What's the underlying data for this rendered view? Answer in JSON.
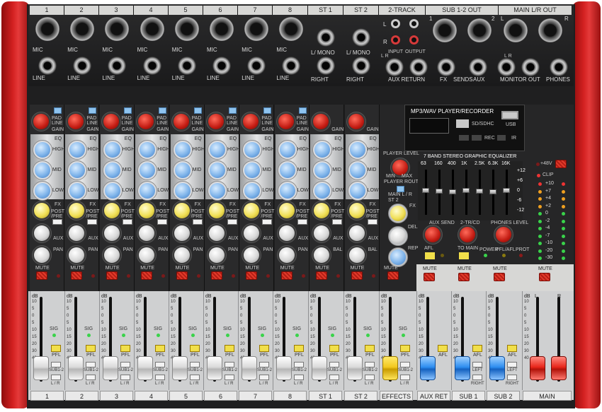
{
  "input_headers": [
    "1",
    "2",
    "3",
    "4",
    "5",
    "6",
    "7",
    "8",
    "ST 1",
    "ST 2",
    "2-TRACK",
    "SUB 1-2 OUT",
    "MAIN L/R OUT"
  ],
  "jacks": {
    "mic": "MIC",
    "line": "LINE",
    "l_mono": "L/ MONO",
    "right": "RIGHT",
    "two_track_l": "L",
    "two_track_r": "R",
    "input": "INPUT",
    "output": "OUTPUT",
    "sub_1": "1",
    "sub_2": "2",
    "main_l": "L",
    "main_r": "R",
    "lr": "L   R",
    "aux_return": "AUX RETURN",
    "fx": "FX",
    "sends": "SENDS",
    "aux": "AUX",
    "monitor_out": "MONITOR OUT",
    "phones": "PHONES"
  },
  "strip": {
    "pad": "PAD",
    "line": "LINE",
    "gain": "GAIN",
    "eq": "EQ",
    "high": "HIGH",
    "mid": "MID",
    "low": "LOW",
    "fx": "FX",
    "post_pre": "POST /PRE",
    "aux": "AUX",
    "pan": "PAN",
    "bal": "BAL",
    "mute": "MUTE",
    "sig": "SIG",
    "pfl": "PFL",
    "sub12": "SUB1-2",
    "lr": "L / R",
    "db": "dB"
  },
  "fader_scale": [
    "10",
    "5",
    "0",
    "5",
    "10",
    "15",
    "20",
    "30",
    "40"
  ],
  "player": {
    "title": "MP3/WAV  PLAYER/RECORDER",
    "sd": "SD/SDHC",
    "usb": "USB",
    "rec": "REC",
    "ir": "IR",
    "level": "PLAYER LEVEL",
    "min": "MIN",
    "max": "MAX",
    "route": "PLAYER ROUTE",
    "main_lr": "MAIN L / R",
    "st2": "ST 2"
  },
  "effects": {
    "fx": "FX",
    "del": "DEL",
    "rep": "REP",
    "min": "MIN",
    "max": "MAX"
  },
  "geq": {
    "title": "7 BAND STEREO GRAPHIC EQUALIZER",
    "bands": [
      "63",
      "160",
      "400",
      "1K",
      "2.5K",
      "6.3K",
      "16K"
    ],
    "scale": [
      "+12",
      "+6",
      "0",
      "-6",
      "-12"
    ]
  },
  "master": {
    "phantom": "+48V",
    "clip": "CLIP",
    "meter": [
      "+10",
      "+7",
      "+4",
      "+2",
      "0",
      "-2",
      "-4",
      "-7",
      "-10",
      "-20",
      "-30"
    ],
    "aux_send": "AUX SEND",
    "afl": "AFL",
    "two_tr_cd": "2-TR/CD",
    "to_main": "TO MAIN",
    "phones_level": "PHONES LEVEL",
    "power": "POWER",
    "pfl_afl": "PFL/AFL",
    "prot": "PROT",
    "mute": "MUTE",
    "left": "LEFT",
    "right": "RIGHT",
    "l": "L",
    "r": "R"
  },
  "fader_labels": [
    "1",
    "2",
    "3",
    "4",
    "5",
    "6",
    "7",
    "8",
    "ST 1",
    "ST 2",
    "EFFECTS",
    "AUX RET",
    "SUB 1",
    "SUB 2",
    "MAIN"
  ],
  "colors": {
    "chassis": "#d32020",
    "panel": "#1f1f20",
    "fader_area": "#cfd0d1",
    "eq_knob": "#7fb4ea",
    "fx_knob": "#f0df55"
  }
}
